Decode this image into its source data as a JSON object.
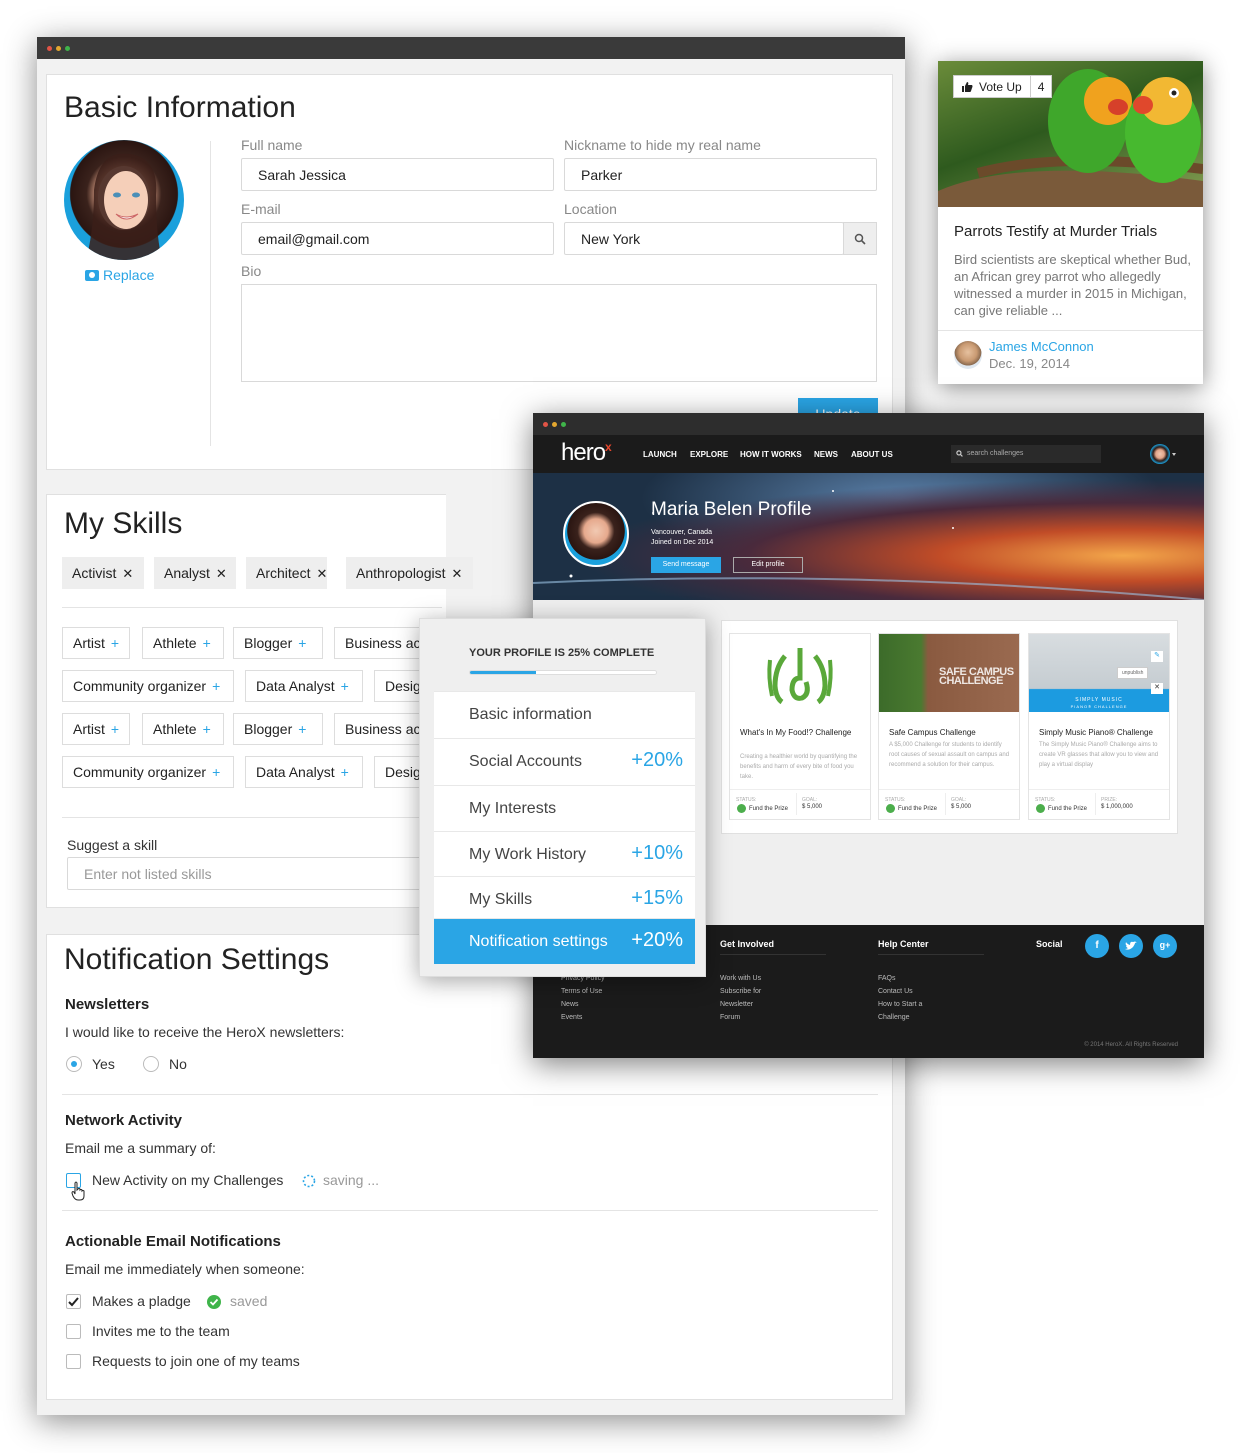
{
  "colors": {
    "accent": "#2aa5e5",
    "dot_red": "#e15446",
    "dot_yellow": "#e3a72f",
    "dot_green": "#3fb44a",
    "dark": "#1b1b1b"
  },
  "basic": {
    "title": "Basic Information",
    "replace": "Replace",
    "fullname_label": "Full name",
    "fullname": "Sarah Jessica",
    "nickname_label": "Nickname to hide my real name",
    "nickname": "Parker",
    "email_label": "E-mail",
    "email": "email@gmail.com",
    "location_label": "Location",
    "location": "New York",
    "bio_label": "Bio",
    "update": "Update"
  },
  "skills": {
    "title": "My Skills",
    "selected": [
      "Activist",
      "Analyst",
      "Architect",
      "Anthropologist"
    ],
    "rows": [
      [
        "Artist",
        "Athlete",
        "Blogger",
        "Business ac"
      ],
      [
        "Community organizer",
        "Data Analyst",
        "Desig"
      ],
      [
        "Artist",
        "Athlete",
        "Blogger",
        "Business ac"
      ],
      [
        "Community organizer",
        "Data Analyst",
        "Desig"
      ]
    ],
    "suggest_label": "Suggest a skill",
    "suggest_placeholder": "Enter not listed skills"
  },
  "notif": {
    "title": "Notification Settings",
    "newsletters": "Newsletters",
    "newsletters_q": "I would like to receive the HeroX newsletters:",
    "yes": "Yes",
    "no": "No",
    "network": "Network Activity",
    "network_q": "Email me a summary of:",
    "new_activity": "New Activity on my Challenges",
    "saving": "saving ...",
    "actionable": "Actionable Email Notifications",
    "actionable_q": "Email me immediately when someone:",
    "opt1": "Makes a pladge",
    "saved": "saved",
    "opt2": "Invites me to the team",
    "opt3": "Requests to join one of my teams"
  },
  "article": {
    "vote": "Vote Up",
    "votes": "4",
    "title": "Parrots Testify at Murder Trials",
    "body": "Bird scientists are skeptical whether Bud, an African grey parrot who allegedly witnessed a murder in 2015 in Michigan, can give reliable ...",
    "author": "James McConnon",
    "date": "Dec. 19, 2014"
  },
  "herox": {
    "logo": "hero",
    "logo_x": "x",
    "nav": [
      "LAUNCH",
      "EXPLORE",
      "HOW IT WORKS",
      "NEWS",
      "ABOUT US"
    ],
    "search_placeholder": "search challenges",
    "profile_name": "Maria Belen Profile",
    "location": "Vancouver, Canada",
    "joined": "Joined on Dec 2014",
    "send": "Send message",
    "edit": "Edit profile",
    "challenges": [
      {
        "title": "What's In My Food!? Challenge",
        "desc": "Creating a healthier world by quantifying the benefits and harm of every bite of food you take.",
        "status_label": "STATUS:",
        "status": "Fund the Prize",
        "goal_label": "GOAL:",
        "goal": "$ 5,000"
      },
      {
        "title": "Safe Campus Challenge",
        "desc": "A $5,000 Challenge for students to identify root causes of sexual assault on campus and recommend a solution for their campus.",
        "status_label": "STATUS:",
        "status": "Fund the Prize",
        "goal_label": "GOAL:",
        "goal": "$ 5,000",
        "image_text": "SAFE CAMPUS CHALLENGE"
      },
      {
        "title": "Simply Music Piano® Challenge",
        "desc": "The Simply Music Piano® Challenge aims to create VR glasses that allow you to view and play a virtual display",
        "status_label": "STATUS:",
        "status": "Fund the Prize",
        "goal_label": "PRIZE:",
        "goal": "$ 1,000,000",
        "image_text": "SIMPLY MUSIC",
        "image_sub": "PIANO® CHALLENGE",
        "unpublish": "unpublish"
      }
    ],
    "footer": {
      "col1": [
        "Privacy Policy",
        "Terms of Use",
        "News",
        "Events"
      ],
      "get_involved": "Get Involved",
      "col2": [
        "Work with Us",
        "Subscribe for",
        "Newsletter",
        "Forum"
      ],
      "help": "Help Center",
      "col3": [
        "FAQs",
        "Contact Us",
        "How to Start a",
        "Challenge"
      ],
      "social": "Social",
      "copyright": "© 2014 HeroX. All Rights Reserved"
    }
  },
  "progress": {
    "title": "YOUR PROFILE IS 25% COMPLETE",
    "percent": 25,
    "items": [
      {
        "label": "Basic information",
        "pct": ""
      },
      {
        "label": "Social Accounts",
        "pct": "+20%"
      },
      {
        "label": "My Interests",
        "pct": ""
      },
      {
        "label": "My Work History",
        "pct": "+10%"
      },
      {
        "label": "My Skills",
        "pct": "+15%"
      },
      {
        "label": "Notification settings",
        "pct": "+20%"
      }
    ]
  }
}
